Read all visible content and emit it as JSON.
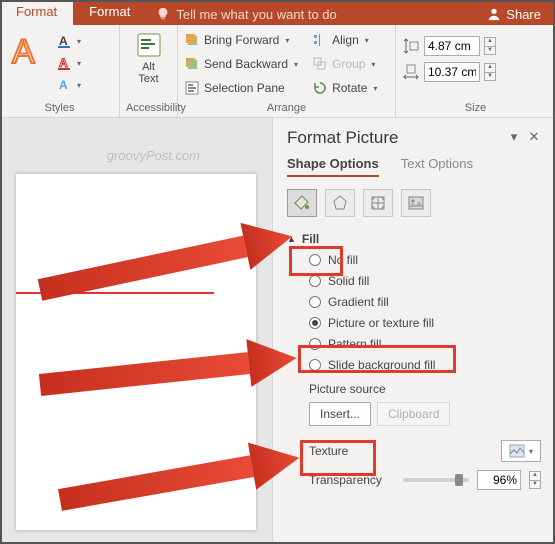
{
  "tabs": {
    "format1": "Format",
    "format2": "Format",
    "tell": "Tell me what you want to do",
    "share": "Share"
  },
  "ribbon": {
    "styles_label": "Styles",
    "acc": {
      "alt_text": "Alt\nText",
      "group_label": "Accessibility"
    },
    "arrange": {
      "bring_forward": "Bring Forward",
      "send_backward": "Send Backward",
      "selection_pane": "Selection Pane",
      "align": "Align",
      "group": "Group",
      "rotate": "Rotate",
      "group_label": "Arrange"
    },
    "size": {
      "h": "4.87 cm",
      "w": "10.37 cm",
      "group_label": "Size"
    }
  },
  "watermark": "groovyPost.com",
  "pane": {
    "title": "Format Picture",
    "shape_options": "Shape Options",
    "text_options": "Text Options",
    "fill_section": "Fill",
    "options": {
      "no_fill": "No fill",
      "solid_fill": "Solid fill",
      "gradient_fill": "Gradient fill",
      "picture_fill": "Picture or texture fill",
      "pattern_fill": "Pattern fill",
      "slide_bg_fill": "Slide background fill"
    },
    "picture_source": "Picture source",
    "insert_btn": "Insert...",
    "clipboard_btn": "Clipboard",
    "texture": "Texture",
    "transparency": "Transparency",
    "transparency_val": "96%"
  }
}
